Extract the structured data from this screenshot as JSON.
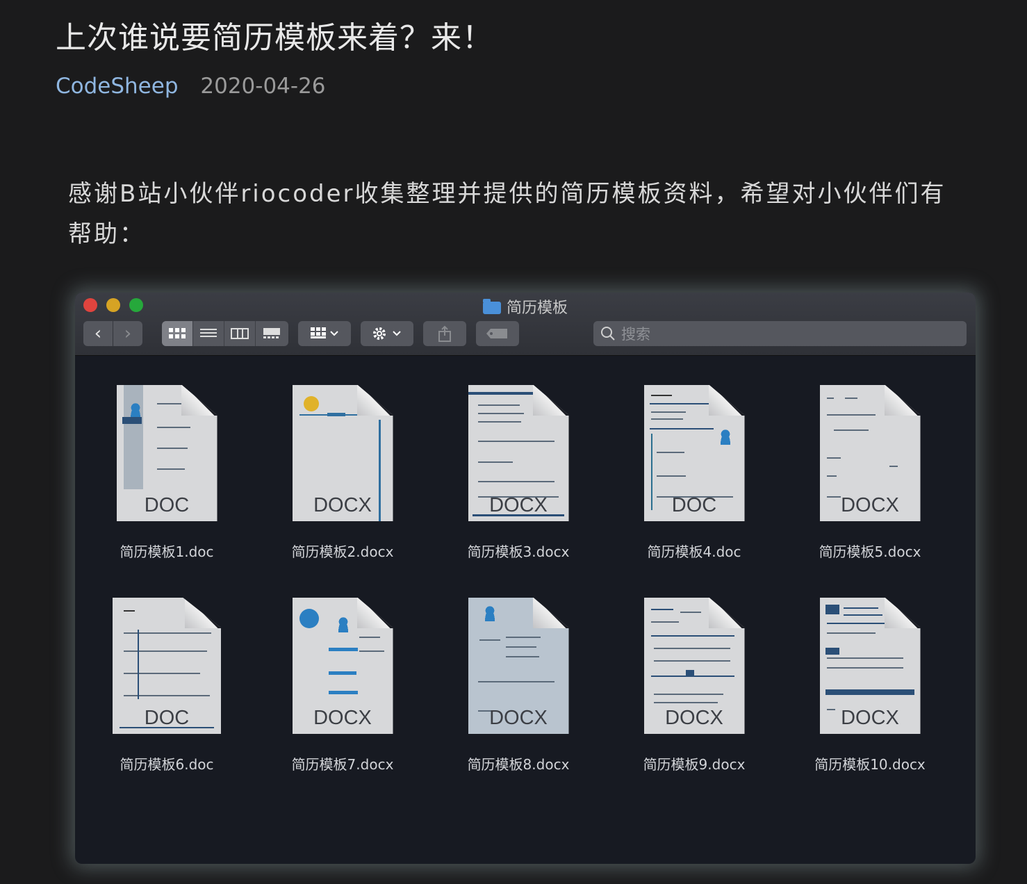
{
  "article": {
    "title": "上次谁说要简历模板来着？来！",
    "author": "CodeSheep",
    "date": "2020-04-26",
    "paragraph": "感谢B站小伙伴riocoder收集整理并提供的简历模板资料，希望对小伙伴们有帮助："
  },
  "window": {
    "title": "简历模板",
    "search_placeholder": "搜索",
    "nav_back": "‹",
    "nav_forward": "›"
  },
  "files": [
    {
      "name": "简历模板1.doc",
      "ext": "DOC"
    },
    {
      "name": "简历模板2.docx",
      "ext": "DOCX"
    },
    {
      "name": "简历模板3.docx",
      "ext": "DOCX"
    },
    {
      "name": "简历模板4.doc",
      "ext": "DOC"
    },
    {
      "name": "简历模板5.docx",
      "ext": "DOCX"
    },
    {
      "name": "简历模板6.doc",
      "ext": "DOC"
    },
    {
      "name": "简历模板7.docx",
      "ext": "DOCX"
    },
    {
      "name": "简历模板8.docx",
      "ext": "DOCX"
    },
    {
      "name": "简历模板9.docx",
      "ext": "DOCX"
    },
    {
      "name": "简历模板10.docx",
      "ext": "DOCX"
    }
  ],
  "colors": {
    "background": "#1b1b1c",
    "author": "#8fb6e0",
    "window_body": "#171a22",
    "toolbar": "#3b3d44"
  }
}
